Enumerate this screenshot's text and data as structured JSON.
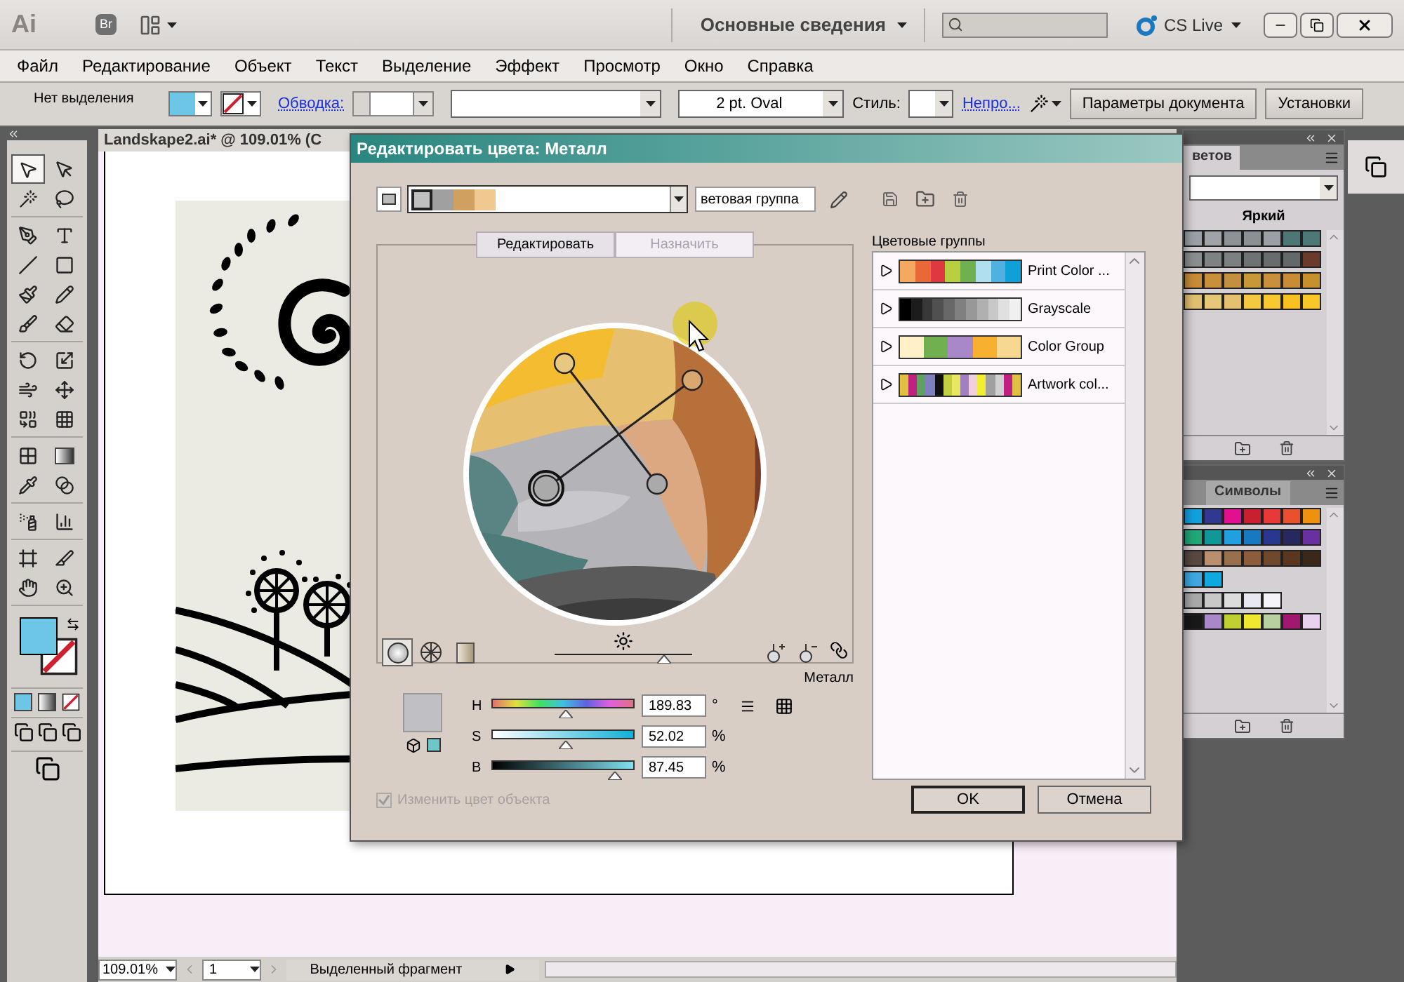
{
  "app_bar": {
    "logo": "Ai",
    "bridge": "Br",
    "workspace": "Основные сведения",
    "cs_live": "CS Live"
  },
  "menu": [
    "Файл",
    "Редактирование",
    "Объект",
    "Текст",
    "Выделение",
    "Эффект",
    "Просмотр",
    "Окно",
    "Справка"
  ],
  "control_bar": {
    "selection_label": "Нет выделения",
    "fill": {
      "color": "#6ec6e6"
    },
    "stroke": {
      "kind": "none"
    },
    "stroke_link": "Обводка:",
    "brush": "2 pt. Oval",
    "style_label": "Стиль:",
    "opacity_link": "Непро...",
    "buttons": [
      "Параметры документа",
      "Установки"
    ]
  },
  "toolbar": {
    "tool_groups": [
      [
        {
          "kind": "arrow",
          "selected": true
        },
        {
          "kind": "direct",
          "selected": false
        },
        {
          "kind": "wand",
          "selected": false
        },
        {
          "kind": "lasso",
          "selected": false
        }
      ],
      [
        {
          "kind": "pen",
          "selected": false
        },
        {
          "kind": "type",
          "selected": false
        },
        {
          "kind": "line",
          "selected": false
        },
        {
          "kind": "rectangle",
          "selected": false
        },
        {
          "kind": "brush",
          "selected": false
        },
        {
          "kind": "pencil",
          "selected": false
        },
        {
          "kind": "blob",
          "selected": false
        },
        {
          "kind": "eraser",
          "selected": false
        }
      ],
      [
        {
          "kind": "rotate",
          "selected": false
        },
        {
          "kind": "scale",
          "selected": false
        },
        {
          "kind": "warp",
          "selected": false
        },
        {
          "kind": "free",
          "selected": false
        },
        {
          "kind": "shape",
          "selected": false
        },
        {
          "kind": "grid",
          "selected": false
        }
      ],
      [
        {
          "kind": "mesh",
          "selected": false
        },
        {
          "kind": "gradient",
          "selected": false
        },
        {
          "kind": "eyedropper",
          "selected": false
        },
        {
          "kind": "blend",
          "selected": false
        }
      ],
      [
        {
          "kind": "sprayer",
          "selected": false
        },
        {
          "kind": "graph",
          "selected": false
        }
      ],
      [
        {
          "kind": "artboard",
          "selected": false
        },
        {
          "kind": "slice",
          "selected": false
        },
        {
          "kind": "hand",
          "selected": false
        },
        {
          "kind": "zoom",
          "selected": false
        }
      ]
    ],
    "fill": {
      "color": "#6ec6e6"
    },
    "stroke": {
      "kind": "none"
    }
  },
  "document": {
    "title": "Landskape2.ai* @ 109.01% (C"
  },
  "dialog": {
    "title": "Редактировать цвета: Металл",
    "current_colors": [
      {
        "color": "#c0c0c0"
      },
      {
        "color": "#a0a0a0"
      },
      {
        "color": "#d0a060"
      },
      {
        "color": "#f0c890"
      }
    ],
    "group_name": "ветовая группа",
    "tabs": [
      {
        "label": "Редактировать",
        "selected": true
      },
      {
        "label": "Назначить",
        "selected": false
      }
    ],
    "wheel_modes": [
      {
        "kind": "smooth",
        "selected": true
      },
      {
        "kind": "segmented",
        "selected": false
      },
      {
        "kind": "bars",
        "selected": false
      }
    ],
    "brightness": {
      "level": 0.8
    },
    "groups_heading": "Цветовые группы",
    "groups": [
      {
        "name": "Print Color ...",
        "colors": [
          {
            "color": "#f4a860"
          },
          {
            "color": "#e86838"
          },
          {
            "color": "#e03840"
          },
          {
            "color": "#b8d040"
          },
          {
            "color": "#70b050"
          },
          {
            "color": "#b0e0f0"
          },
          {
            "color": "#50b0e0"
          },
          {
            "color": "#10a0d8"
          }
        ]
      },
      {
        "name": "Grayscale",
        "colors": [
          {
            "color": "#000000"
          },
          {
            "color": "#1c1c1c"
          },
          {
            "color": "#383838"
          },
          {
            "color": "#505050"
          },
          {
            "color": "#686868"
          },
          {
            "color": "#808080"
          },
          {
            "color": "#989898"
          },
          {
            "color": "#b0b0b0"
          },
          {
            "color": "#c8c8c8"
          },
          {
            "color": "#e0e0e0"
          },
          {
            "color": "#f0f0f0"
          }
        ]
      },
      {
        "name": "Color Group",
        "colors": [
          {
            "color": "#fff0c8"
          },
          {
            "color": "#70b050"
          },
          {
            "color": "#a888c8"
          },
          {
            "color": "#f8b030"
          },
          {
            "color": "#f8d890"
          }
        ]
      },
      {
        "name": "Artwork col...",
        "colors": [
          {
            "color": "#e0c040"
          },
          {
            "color": "#c02080"
          },
          {
            "color": "#60a060"
          },
          {
            "color": "#8080c0"
          },
          {
            "color": "#101010"
          },
          {
            "color": "#c0d040"
          },
          {
            "color": "#e8e860"
          },
          {
            "color": "#a080c0"
          },
          {
            "color": "#f0d0e0"
          },
          {
            "color": "#f0f030"
          },
          {
            "color": "#a0a0a0"
          },
          {
            "color": "#d0d0d0"
          },
          {
            "color": "#c02080"
          },
          {
            "color": "#e0c040"
          }
        ]
      }
    ],
    "active_name": "Металл",
    "active_swatch": {
      "color": "#c0c0c4"
    },
    "web_swatch": {
      "color": "#6ec6c8"
    },
    "sliders": [
      {
        "label": "H",
        "value": "189.83",
        "unit": "°",
        "level": 0.52,
        "kind": "hue"
      },
      {
        "label": "S",
        "value": "52.02",
        "unit": "%",
        "level": 0.52,
        "kind": "saturation"
      },
      {
        "label": "B",
        "value": "87.45",
        "unit": "%",
        "level": 0.87,
        "kind": "brightness"
      }
    ],
    "recolor": {
      "label": "Изменить цвет объекта",
      "checked": true,
      "disabled": true
    },
    "buttons": [
      "OK",
      "Отмена"
    ]
  },
  "panels": [
    {
      "tab": "ветов",
      "title": "Яркий",
      "rows": [
        [
          {
            "color": "#9aa0a6"
          },
          {
            "color": "#a0a4a8"
          },
          {
            "color": "#8c9296"
          },
          {
            "color": "#8a9094"
          },
          {
            "color": "#9aa0a6"
          },
          {
            "color": "#4e7674"
          },
          {
            "color": "#4c7878"
          }
        ],
        [
          {
            "color": "#8a8e90"
          },
          {
            "color": "#7e8284"
          },
          {
            "color": "#7c8082"
          },
          {
            "color": "#6e7274"
          },
          {
            "color": "#686c6e"
          },
          {
            "color": "#64686a"
          },
          {
            "color": "#6a3a2a"
          }
        ],
        [
          {
            "color": "#c88c38"
          },
          {
            "color": "#c8903a"
          },
          {
            "color": "#c49040"
          },
          {
            "color": "#c89838"
          },
          {
            "color": "#c8903c"
          },
          {
            "color": "#c88c34"
          },
          {
            "color": "#c8902c"
          }
        ],
        [
          {
            "color": "#e0c070"
          },
          {
            "color": "#e4c878"
          },
          {
            "color": "#e4c070"
          },
          {
            "color": "#f4c840"
          },
          {
            "color": "#f8c830"
          },
          {
            "color": "#f8c020"
          },
          {
            "color": "#f8c828"
          }
        ]
      ]
    },
    {
      "tab": "Символы",
      "rows": [
        [
          {
            "color": "#10a0e0"
          },
          {
            "color": "#303890"
          },
          {
            "color": "#e01090"
          },
          {
            "color": "#c82030"
          },
          {
            "color": "#e83838"
          },
          {
            "color": "#e85030"
          },
          {
            "color": "#f09010"
          }
        ],
        [
          {
            "color": "#20a878"
          },
          {
            "color": "#109898"
          },
          {
            "color": "#20a0e0"
          },
          {
            "color": "#1878c0"
          },
          {
            "color": "#283890"
          },
          {
            "color": "#282860"
          },
          {
            "color": "#6830a0"
          }
        ],
        [
          {
            "color": "#584840"
          },
          {
            "color": "#b89070"
          },
          {
            "color": "#98704c"
          },
          {
            "color": "#8c5c3c"
          },
          {
            "color": "#70482c"
          },
          {
            "color": "#5a3820"
          },
          {
            "color": "#3c2818"
          }
        ],
        [
          {
            "color": "#40a8e0"
          },
          {
            "color": "#10a8e0"
          }
        ],
        [
          {
            "color": "#a8a8a8"
          },
          {
            "color": "#c8c8c8"
          },
          {
            "color": "#dcdcdc"
          },
          {
            "color": "#e8e8f0"
          },
          {
            "color": "#f4f4f8"
          }
        ],
        [
          {
            "color": "#181818"
          },
          {
            "color": "#a888c8"
          },
          {
            "color": "#c0d030"
          },
          {
            "color": "#f0e830"
          },
          {
            "color": "#b8d0a0"
          },
          {
            "color": "#a01870"
          },
          {
            "color": "#e8d0f0"
          }
        ]
      ]
    }
  ],
  "status_bar": {
    "zoom": "109.01%",
    "page": "1",
    "status": "Выделенный фрагмент"
  }
}
